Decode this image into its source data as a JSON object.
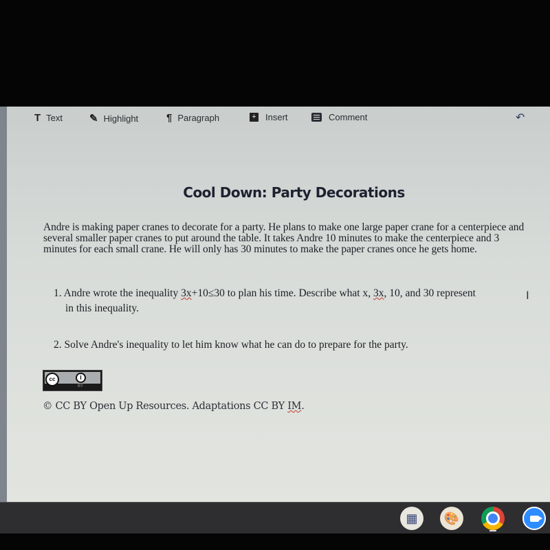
{
  "toolbar": {
    "items": [
      {
        "label": "Text",
        "icon": "text-T-icon"
      },
      {
        "label": "Highlight",
        "icon": "highlighter-icon"
      },
      {
        "label": "Paragraph",
        "icon": "paragraph-icon"
      },
      {
        "label": "Insert",
        "icon": "plus-box-icon"
      },
      {
        "label": "Comment",
        "icon": "comment-icon"
      }
    ],
    "undo_icon": "↶",
    "redo_icon": "↷"
  },
  "document": {
    "title": "Cool Down: Party Decorations",
    "paragraph": "Andre is making paper cranes to decorate for a party. He plans to make one large paper crane for a centerpiece and several smaller paper cranes to put around the table. It takes Andre 10 minutes to make the centerpiece and 3 minutes for each small crane. He will only has 30 minutes to make the paper cranes once he gets home.",
    "question1": {
      "number": "1.",
      "pre": "Andre wrote the inequality ",
      "inequality_a": "3x",
      "inequality_b": "+10≤30",
      "mid": " to plan his time. Describe what x, ",
      "term": "3x",
      "post": ", 10, and 30 represent",
      "line2": "in this inequality."
    },
    "question2": {
      "number": "2.",
      "text": "Solve Andre's inequality to let him know what he can do to prepare for the party."
    },
    "license_badge": {
      "cc": "cc",
      "by": "BY"
    },
    "copyright_pre": "© CC BY Open Up Resources. Adaptations CC BY ",
    "copyright_im": "IM",
    "copyright_end": "."
  },
  "shelf": {
    "apps": [
      "calculator",
      "paint",
      "chrome",
      "zoom"
    ],
    "active_app": "chrome"
  }
}
